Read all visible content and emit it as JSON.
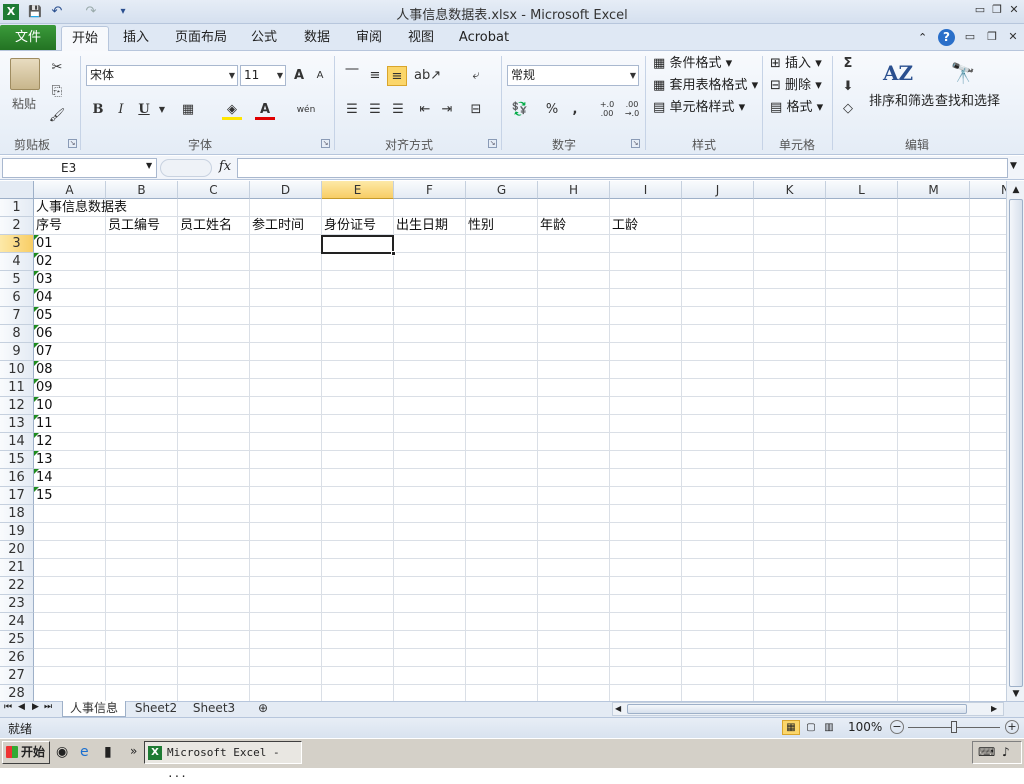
{
  "window": {
    "title": "人事信息数据表.xlsx  -  Microsoft Excel",
    "minimize": "▭",
    "restore": "❐",
    "close": "✕",
    "app_icon": "excel-icon"
  },
  "qat": {
    "save": "💾",
    "undo": "↶",
    "redo": "↷",
    "customize": "▾"
  },
  "ribbon_tabs": [
    {
      "label": "文件"
    },
    {
      "label": "开始"
    },
    {
      "label": "插入"
    },
    {
      "label": "页面布局"
    },
    {
      "label": "公式"
    },
    {
      "label": "数据"
    },
    {
      "label": "审阅"
    },
    {
      "label": "视图"
    },
    {
      "label": "Acrobat"
    }
  ],
  "ribbon": {
    "clipboard": {
      "paste": "粘贴",
      "group": "剪贴板"
    },
    "font": {
      "name": "宋体",
      "size": "11",
      "bold": "B",
      "italic": "I",
      "underline": "U",
      "group": "字体",
      "grow": "A",
      "shrink": "A",
      "color_glyph": "A",
      "phonetic": "wén"
    },
    "alignment": {
      "group": "对齐方式"
    },
    "number": {
      "format": "常规",
      "percent": "%",
      "comma": ",",
      "group": "数字",
      "inc_dec": "+.0 .00",
      "dec_dec": ".00 →.0"
    },
    "styles": {
      "conditional": "条件格式",
      "table": "套用表格格式",
      "cell": "单元格样式",
      "group": "样式"
    },
    "cells": {
      "insert": "插入",
      "delete": "删除",
      "format": "格式",
      "group": "单元格"
    },
    "editing": {
      "sum": "Σ",
      "sort": "排序和筛选",
      "find": "查找和选择",
      "group": "编辑"
    }
  },
  "formula_bar": {
    "name_box": "E3",
    "fx": "fx",
    "value": ""
  },
  "columns": [
    "A",
    "B",
    "C",
    "D",
    "E",
    "F",
    "G",
    "H",
    "I",
    "J",
    "K",
    "L",
    "M",
    "N"
  ],
  "rows": [
    "1",
    "2",
    "3",
    "4",
    "5",
    "6",
    "7",
    "8",
    "9",
    "10",
    "11",
    "12",
    "13",
    "14",
    "15",
    "16",
    "17",
    "18",
    "19",
    "20",
    "21",
    "22",
    "23",
    "24",
    "25",
    "26",
    "27",
    "28"
  ],
  "selected": {
    "col": "E",
    "row": "3"
  },
  "cells": {
    "A1": "人事信息数据表",
    "A2": "序号",
    "B2": "员工编号",
    "C2": "员工姓名",
    "D2": "参工时间",
    "E2": "身份证号",
    "F2": "出生日期",
    "G2": "性别",
    "H2": "年龄",
    "I2": "工龄",
    "A3": "01",
    "A4": "02",
    "A5": "03",
    "A6": "04",
    "A7": "05",
    "A8": "06",
    "A9": "07",
    "A10": "08",
    "A11": "09",
    "A12": "10",
    "A13": "11",
    "A14": "12",
    "A15": "13",
    "A16": "14",
    "A17": "15"
  },
  "sheet_tabs": [
    {
      "label": "人事信息",
      "active": true
    },
    {
      "label": "Sheet2",
      "active": false
    },
    {
      "label": "Sheet3",
      "active": false
    }
  ],
  "status": {
    "ready": "就绪",
    "zoom": "100%"
  },
  "taskbar": {
    "start": "开始",
    "item": "Microsoft Excel - ..."
  }
}
